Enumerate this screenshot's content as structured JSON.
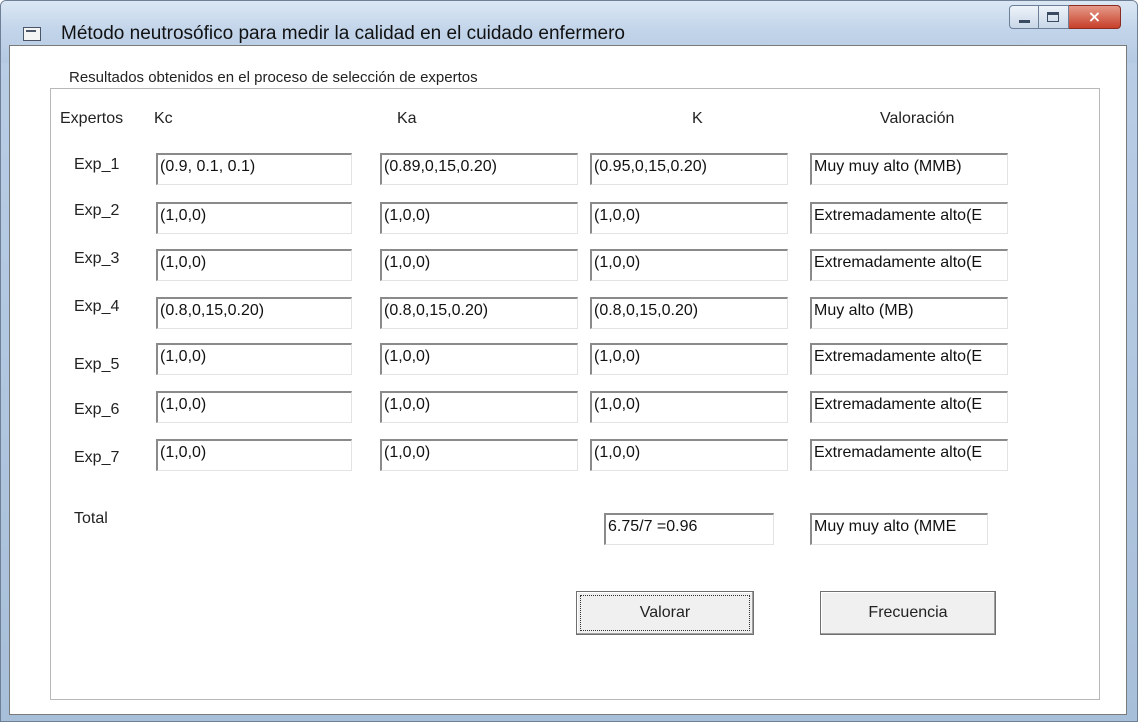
{
  "window": {
    "title": "Método neutrosófico para medir la calidad en el cuidado enfermero",
    "close_glyph": "×"
  },
  "group": {
    "label": "Resultados obtenidos en el proceso de selección de expertos"
  },
  "headers": {
    "expertos": "Expertos",
    "kc": "Kc",
    "ka": "Ka",
    "k": "K",
    "valoracion": "Valoración"
  },
  "rows": [
    {
      "label": "Exp_1",
      "kc": "(0.9, 0.1, 0.1)",
      "ka": "(0.89,0,15,0.20)",
      "k": "(0.95,0,15,0.20)",
      "valoracion": "Muy muy alto (MMB)"
    },
    {
      "label": "Exp_2",
      "kc": "(1,0,0)",
      "ka": "(1,0,0)",
      "k": "(1,0,0)",
      "valoracion": "Extremadamente alto(E"
    },
    {
      "label": "Exp_3",
      "kc": "(1,0,0)",
      "ka": "(1,0,0)",
      "k": "(1,0,0)",
      "valoracion": "Extremadamente alto(E"
    },
    {
      "label": "Exp_4",
      "kc": "(0.8,0,15,0.20)",
      "ka": "(0.8,0,15,0.20)",
      "k": "(0.8,0,15,0.20)",
      "valoracion": "Muy alto (MB)"
    },
    {
      "label": "Exp_5",
      "kc": "(1,0,0)",
      "ka": "(1,0,0)",
      "k": "(1,0,0)",
      "valoracion": "Extremadamente alto(E"
    },
    {
      "label": "Exp_6",
      "kc": "(1,0,0)",
      "ka": "(1,0,0)",
      "k": "(1,0,0)",
      "valoracion": "Extremadamente alto(E"
    },
    {
      "label": "Exp_7",
      "kc": "(1,0,0)",
      "ka": "(1,0,0)",
      "k": "(1,0,0)",
      "valoracion": "Extremadamente alto(E"
    }
  ],
  "total": {
    "label": "Total",
    "k": "6.75/7 =0.96",
    "valoracion": "Muy muy alto (MME"
  },
  "buttons": {
    "valorar": "Valorar",
    "frecuencia": "Frecuencia"
  }
}
